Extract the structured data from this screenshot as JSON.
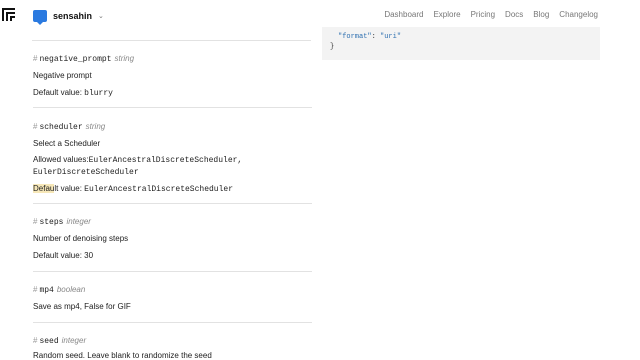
{
  "header": {
    "username": "sensahin",
    "nav": [
      "Dashboard",
      "Explore",
      "Pricing",
      "Docs",
      "Blog",
      "Changelog"
    ]
  },
  "code": {
    "line1_key": "\"format\"",
    "line1_val": "\"uri\"",
    "line2": "}"
  },
  "params": {
    "negative_prompt": {
      "name": "negative_prompt",
      "type": "string",
      "description": "Negative prompt",
      "default_label": "Default value:",
      "default_value": "blurry"
    },
    "scheduler": {
      "name": "scheduler",
      "type": "string",
      "description": "Select a Scheduler",
      "allowed_label": "Allowed values:",
      "allowed_values": "EulerAncestralDiscreteScheduler,",
      "allowed_values_2": "EulerDiscreteScheduler",
      "default_label_a": "Defau",
      "default_label_b": "lt value:",
      "default_value": "EulerAncestralDiscreteScheduler"
    },
    "steps": {
      "name": "steps",
      "type": "integer",
      "description": "Number of denoising steps",
      "default_label": "Default value:",
      "default_value": "30"
    },
    "mp4": {
      "name": "mp4",
      "type": "boolean",
      "description": "Save as mp4, False for GIF"
    },
    "seed": {
      "name": "seed",
      "type": "integer",
      "description": "Random seed. Leave blank to randomize the seed"
    }
  }
}
